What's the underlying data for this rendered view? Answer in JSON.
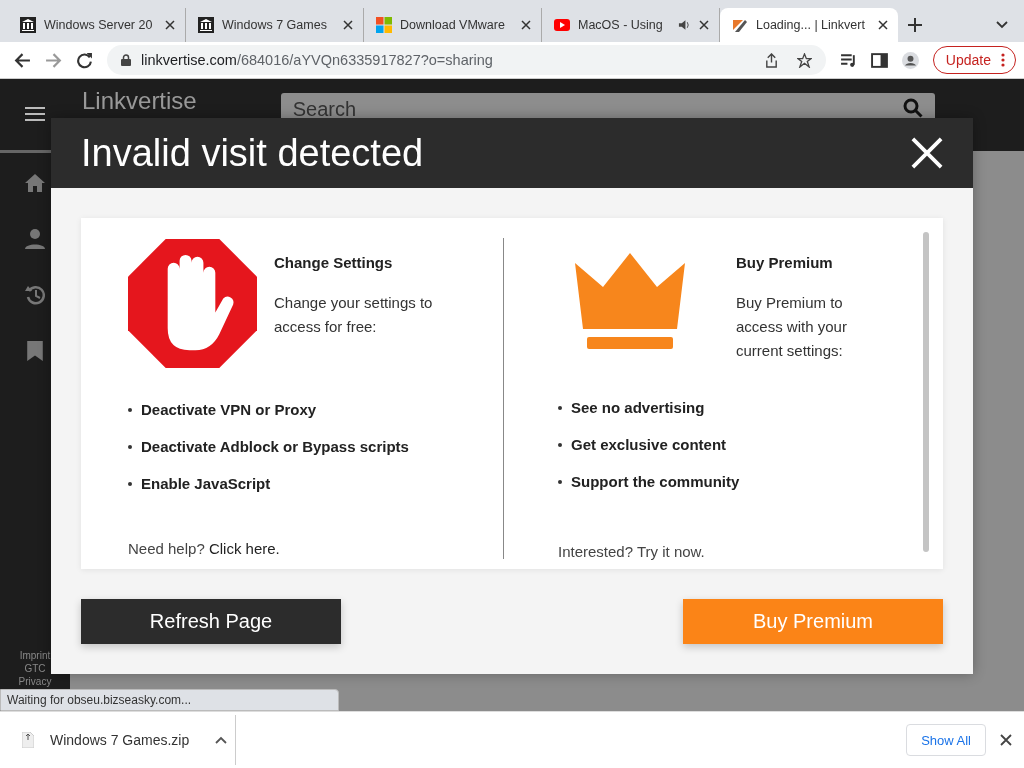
{
  "browser": {
    "tabs": [
      {
        "label": "Windows Server 20",
        "kind": "bank",
        "audio": false,
        "selected": false
      },
      {
        "label": "Windows 7 Games",
        "kind": "bank",
        "audio": false,
        "selected": false
      },
      {
        "label": "Download VMware",
        "kind": "windows",
        "audio": false,
        "selected": false
      },
      {
        "label": "MacOS - Using",
        "kind": "video",
        "audio": true,
        "selected": false
      },
      {
        "label": "Loading... | Linkvert",
        "kind": "brand",
        "audio": false,
        "selected": true
      }
    ],
    "url_host": "linkvertise.com",
    "url_path": "/684016/aYVQn6335917827?o=sharing",
    "update_button": "Update"
  },
  "site": {
    "logo": "Linkvertise",
    "search": {
      "placeholder": "Search"
    },
    "footer_links": [
      "Imprint",
      "GTC",
      "Privacy"
    ]
  },
  "modal": {
    "title": "Invalid visit detected",
    "left": {
      "heading": "Change Settings",
      "text": "Change your settings to access for free:",
      "bullets": [
        "Deactivate VPN or Proxy",
        "Deactivate Adblock or Bypass scripts",
        "Enable JavaScript"
      ],
      "help": "Need help?",
      "help_link": "Click here."
    },
    "right": {
      "heading": "Buy Premium",
      "text": "Buy Premium to access with your current settings:",
      "bullets": [
        "See no advertising",
        "Get exclusive content",
        "Support the community"
      ],
      "footer": "Interested? Try it now."
    },
    "buttons": [
      {
        "label": "Refresh Page",
        "kind": "dark"
      },
      {
        "label": "Buy Premium",
        "kind": "accent"
      }
    ]
  },
  "status_bubble": "Waiting for obseu.bizseasky.com...",
  "downloads": {
    "file": "Windows 7 Games.zip",
    "show_all": "Show All"
  }
}
